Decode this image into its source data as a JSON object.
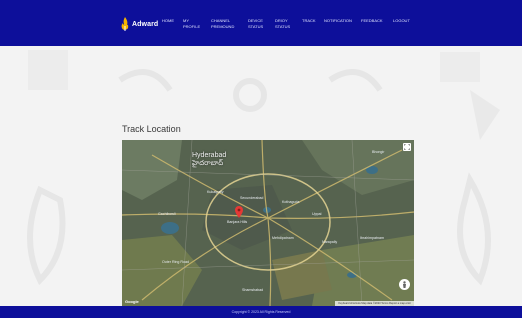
{
  "brand": {
    "name": "Adward"
  },
  "nav": {
    "items": [
      {
        "label": "HOME"
      },
      {
        "label": "MY\nPROFILE"
      },
      {
        "label": "CHANNEL\nPREMOUND"
      },
      {
        "label": "DEVICE\nSTATUS"
      },
      {
        "label": "DRIOY\nSTATUS"
      },
      {
        "label": "TRACK"
      },
      {
        "label": "NOTIFICATION"
      },
      {
        "label": "FEEDBACK"
      },
      {
        "label": "LOGOUT"
      }
    ]
  },
  "main": {
    "title": "Track Location"
  },
  "map": {
    "city": "Hyderabad",
    "city_local": "హైదరాబాద్",
    "areas": [
      {
        "text": "Secunderabad"
      },
      {
        "text": "Gachibowli"
      },
      {
        "text": "Uppal"
      },
      {
        "text": "Banjara Hills"
      },
      {
        "text": "Shamshabad"
      },
      {
        "text": "Ibrahimpatnam"
      },
      {
        "text": "Narapally"
      },
      {
        "text": "Mehdipatnam"
      },
      {
        "text": "Kukatpally"
      },
      {
        "text": "Kothaguda"
      },
      {
        "text": "Bhongir"
      },
      {
        "text": "Outer Ring Road"
      }
    ],
    "google_label": "Google",
    "attribution": "Keyboard shortcuts  Map data ©2023  Terms  Report a map error"
  },
  "footer": {
    "text": "Copyright © 2023 All Rights Reserved"
  },
  "colors": {
    "nav_bg": "#0d0f9a",
    "page_bg": "#f3f3f3",
    "marker": "#e53935"
  }
}
